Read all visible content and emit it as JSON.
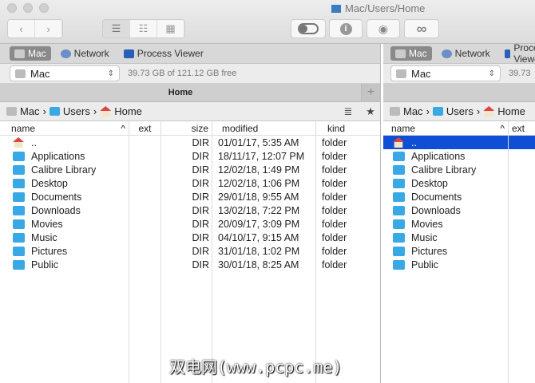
{
  "window": {
    "title": "Mac/Users/Home"
  },
  "toolbar": {
    "back": "‹",
    "forward": "›",
    "view_list": "☰",
    "view_brief": "☷",
    "view_thumbs": "▦",
    "info": "i",
    "preview": "◉",
    "search": "∞"
  },
  "tabs": [
    "Mac",
    "Network",
    "Process Viewer"
  ],
  "volume": {
    "name": "Mac",
    "free": "39.73 GB of 121.12 GB free",
    "right_free": "39.73"
  },
  "tab_header": {
    "title": "Home",
    "add": "+"
  },
  "path": {
    "segments": [
      "Mac",
      "Users",
      "Home"
    ],
    "sep": "›",
    "list_icon": "≣",
    "star": "★"
  },
  "columns": {
    "name": "name",
    "ext": "ext",
    "size": "size",
    "modified": "modified",
    "kind": "kind",
    "sort": "^"
  },
  "files": [
    {
      "name": "..",
      "size": "DIR",
      "modified": "01/01/17, 5:35 AM",
      "kind": "folder"
    },
    {
      "name": "Applications",
      "size": "DIR",
      "modified": "18/11/17, 12:07 PM",
      "kind": "folder"
    },
    {
      "name": "Calibre Library",
      "size": "DIR",
      "modified": "12/02/18, 1:49 PM",
      "kind": "folder"
    },
    {
      "name": "Desktop",
      "size": "DIR",
      "modified": "12/02/18, 1:06 PM",
      "kind": "folder"
    },
    {
      "name": "Documents",
      "size": "DIR",
      "modified": "29/01/18, 9:55 AM",
      "kind": "folder"
    },
    {
      "name": "Downloads",
      "size": "DIR",
      "modified": "13/02/18, 7:22 PM",
      "kind": "folder"
    },
    {
      "name": "Movies",
      "size": "DIR",
      "modified": "20/09/17, 3:09 PM",
      "kind": "folder"
    },
    {
      "name": "Music",
      "size": "DIR",
      "modified": "04/10/17, 9:15 AM",
      "kind": "folder"
    },
    {
      "name": "Pictures",
      "size": "DIR",
      "modified": "31/01/18, 1:02 PM",
      "kind": "folder"
    },
    {
      "name": "Public",
      "size": "DIR",
      "modified": "30/01/18, 8:25 AM",
      "kind": "folder"
    }
  ],
  "selection_color": "#0f4fd6",
  "watermark": "双电网(www.pcpc.me)"
}
